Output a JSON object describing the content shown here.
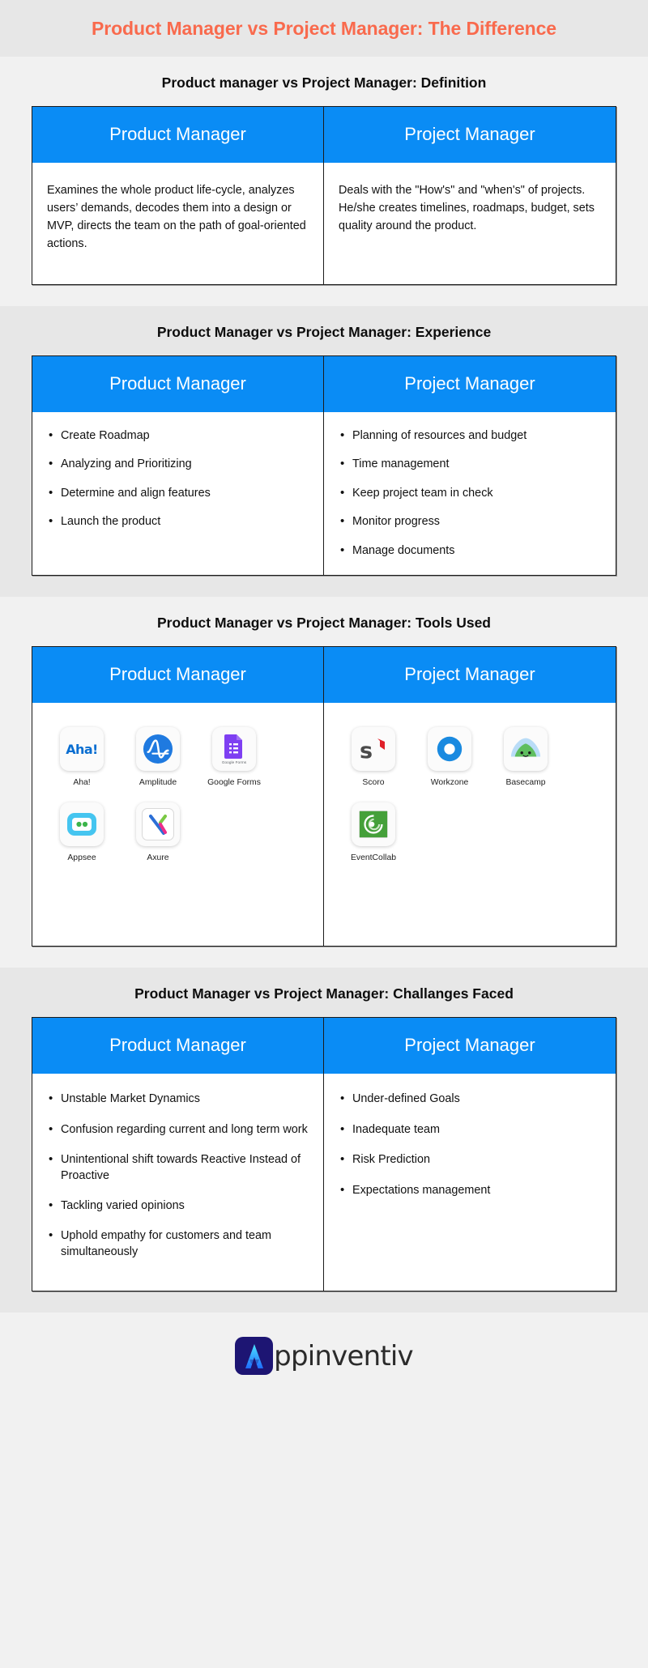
{
  "header": {
    "title": "Product Manager vs Project Manager: The Difference",
    "accent_color": "#f96a4d",
    "background_color": "#e7e7e7"
  },
  "theme": {
    "header_cell_blue": "#0a8cf5",
    "page_background_light": "#f1f1f1",
    "page_background_dark": "#e7e7e7",
    "border_color": "#1b1b1b"
  },
  "sections": [
    {
      "id": "definition",
      "title": "Product manager vs Project Manager: Definition",
      "left": {
        "heading": "Product Manager",
        "paragraph": "Examines the  whole product life-cycle, analyzes users’ demands, decodes them into a design or MVP, directs the team on the path of goal-oriented actions."
      },
      "right": {
        "heading": "Project Manager",
        "paragraph": "Deals with the \"How's\" and \"when's\" of projects. He/she creates timelines, roadmaps, budget, sets quality around the product."
      }
    },
    {
      "id": "experience",
      "title": "Product Manager vs Project Manager: Experience",
      "left": {
        "heading": "Product Manager",
        "bullets": [
          "Create Roadmap",
          "Analyzing and Prioritizing",
          "Determine and align features",
          "Launch the product"
        ]
      },
      "right": {
        "heading": "Project Manager",
        "bullets": [
          "Planning of resources and budget",
          "Time management",
          "Keep project team in check",
          "Monitor progress",
          "Manage documents"
        ]
      }
    },
    {
      "id": "tools",
      "title": "Product Manager vs Project Manager: Tools Used",
      "left": {
        "heading": "Product Manager",
        "tools": [
          {
            "name": "Aha!",
            "icon": "aha-icon"
          },
          {
            "name": "Amplitude",
            "icon": "amplitude-icon"
          },
          {
            "name": "Google Forms",
            "icon": "google-forms-icon",
            "icon_caption": "Google Forms"
          },
          {
            "name": "Appsee",
            "icon": "appsee-icon"
          },
          {
            "name": "Axure",
            "icon": "axure-icon"
          }
        ]
      },
      "right": {
        "heading": "Project Manager",
        "tools": [
          {
            "name": "Scoro",
            "icon": "scoro-icon"
          },
          {
            "name": "Workzone",
            "icon": "workzone-icon"
          },
          {
            "name": "Basecamp",
            "icon": "basecamp-icon"
          },
          {
            "name": "EventCollab",
            "icon": "eventcollab-icon"
          }
        ]
      }
    },
    {
      "id": "challenges",
      "title": "Product Manager vs Project Manager: Challanges Faced",
      "left": {
        "heading": "Product Manager",
        "bullets": [
          "Unstable Market Dynamics",
          "Confusion regarding current and long term work",
          "Unintentional shift towards Reactive Instead of Proactive",
          "Tackling varied opinions",
          "Uphold empathy for customers and team simultaneously"
        ]
      },
      "right": {
        "heading": "Project Manager",
        "bullets": [
          "Under-defined Goals",
          "Inadequate team",
          "Risk Prediction",
          "Expectations management"
        ]
      }
    }
  ],
  "footer": {
    "brand_name": "ppinventiv",
    "brand_initial": "A",
    "brand_mark_color": "#1d1573"
  }
}
